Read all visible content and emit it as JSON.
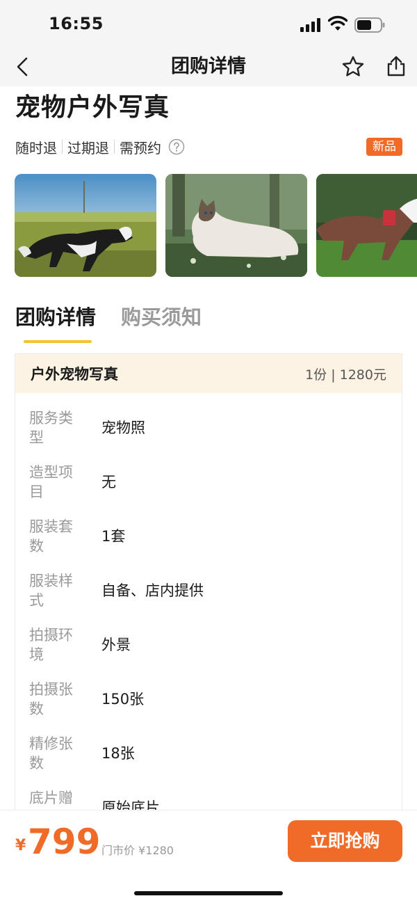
{
  "status_bar": {
    "time": "16:55"
  },
  "nav": {
    "title": "团购详情",
    "back_icon": "chevron-left-icon",
    "star_icon": "star-icon",
    "share_icon": "share-icon"
  },
  "product": {
    "title": "宠物户外写真",
    "tags": [
      "随时退",
      "过期退",
      "需预约"
    ],
    "badge": "新品"
  },
  "photos": [
    {
      "subject": "border-collie-running-on-grass"
    },
    {
      "subject": "ragdoll-cat-on-grass"
    },
    {
      "subject": "border-collie-with-harness"
    }
  ],
  "tabs": [
    {
      "label": "团购详情",
      "active": true
    },
    {
      "label": "购买须知",
      "active": false
    }
  ],
  "package": {
    "name": "户外宠物写真",
    "quantity_price": "1份 | 1280元",
    "rows": [
      {
        "label": "服务类型",
        "value": "宠物照"
      },
      {
        "label": "造型项目",
        "value": "无"
      },
      {
        "label": "服装套数",
        "value": "1套"
      },
      {
        "label": "服装样式",
        "value": "自备、店内提供"
      },
      {
        "label": "拍摄环境",
        "value": "外景"
      },
      {
        "label": "拍摄张数",
        "value": "150张"
      },
      {
        "label": "精修张数",
        "value": "18张"
      },
      {
        "label": "底片赠送",
        "value": "原始底片"
      }
    ]
  },
  "bottom": {
    "currency": "¥",
    "price": "799",
    "market_price": "门市价 ¥1280",
    "buy_label": "立即抢购"
  },
  "colors": {
    "accent": "#f06a28",
    "tab_underline": "#f5c232",
    "card_header": "#fdf3e5"
  }
}
